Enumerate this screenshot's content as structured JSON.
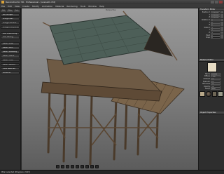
{
  "window": {
    "title": "Reconstructor 3D - Professional - [scene01.r3d]"
  },
  "menu": [
    "File",
    "Edit",
    "View",
    "Create",
    "Modify",
    "Animation",
    "Material",
    "Rendering",
    "Tools",
    "Window",
    "Help"
  ],
  "left_panel": {
    "tabs": [
      "Edit",
      "Mode",
      "Tools"
    ],
    "group1": [
      "Mk. Bridge",
      "Bridge Wall",
      "Bridge Surface",
      "Bridge Component"
    ],
    "group2": [
      "Add Scaffolding",
      "Add Railing"
    ],
    "group3": [
      "Select Pillar",
      "Select Roof",
      "Select Walkway",
      "Select Stairs",
      "Select Floor",
      "Select Beams",
      "Hide Selected",
      "Show All"
    ]
  },
  "viewport": {
    "label": "Perspective"
  },
  "right_panel": {
    "transform_header": "Transform Editor",
    "transform_rows": [
      {
        "label": "Position X",
        "value": "0.000000"
      },
      {
        "label": "Y",
        "value": "0.000000"
      },
      {
        "label": "Z",
        "value": "0.000000"
      },
      {
        "label": "Rotation X",
        "value": "0"
      },
      {
        "label": "Y",
        "value": "0"
      },
      {
        "label": "Z",
        "value": "0"
      },
      {
        "label": "Scale X",
        "value": "1"
      },
      {
        "label": "Y",
        "value": "1"
      },
      {
        "label": "Z",
        "value": "1"
      },
      {
        "label": "Pivot",
        "value": "0"
      },
      {
        "label": "Snap",
        "value": "0"
      }
    ],
    "material_header": "Material Editor",
    "material_rows": [
      {
        "label": "Name",
        "value": "Default"
      },
      {
        "label": "Diffuse",
        "value": "Color"
      },
      {
        "label": "Ambient",
        "value": "0.5"
      },
      {
        "label": "Specular",
        "value": "0.2"
      },
      {
        "label": "Shininess",
        "value": "10"
      },
      {
        "label": "Opacity",
        "value": "1.0"
      },
      {
        "label": "Bump",
        "value": "None"
      }
    ],
    "swatch_color": "#e6dcc4",
    "object_header": "Object Properties"
  },
  "statusbar": {
    "text": "Pillar selected (Polygons: 2143)"
  }
}
